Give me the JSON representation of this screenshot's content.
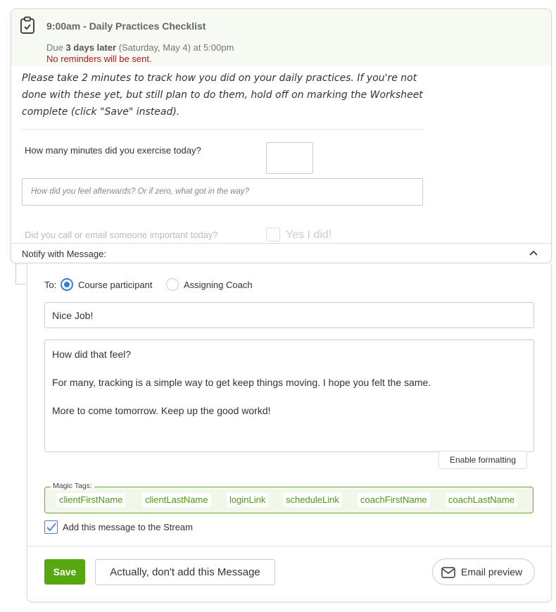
{
  "task": {
    "title": "9:00am - Daily Practices Checklist",
    "due_prefix": "Due ",
    "due_bold": "3 days later",
    "due_suffix": " (Saturday, May 4) at 5:00pm",
    "reminders": "No reminders will be sent.",
    "icon": "clipboard-check-icon"
  },
  "worksheet": {
    "intro": "Please take 2 minutes to track how you did on your daily practices. If you're not done with these yet, but still plan to do them, hold off on marking the Worksheet complete (click \"Save\" instead).",
    "q1": "How many minutes did you exercise today?",
    "q1_value": "",
    "feel_placeholder": "How did you feel afterwards? Or if zero, what got in the way?",
    "q2": "Did you call or email someone important today?",
    "q2_option": "Yes I did!"
  },
  "notify": {
    "label": "Notify with Message:"
  },
  "message": {
    "to_label": "To:",
    "recipients": [
      {
        "label": "Course participant",
        "selected": true
      },
      {
        "label": "Assigning Coach",
        "selected": false
      }
    ],
    "subject": "Nice Job!",
    "body": [
      "How did that feel?",
      "For many, tracking is a simple way to get keep things moving. I hope you felt the same.",
      "More to come tomorrow. Keep up the good workd!"
    ],
    "enable_formatting": "Enable formatting",
    "magic_tags_label": "Magic Tags:",
    "magic_tags": [
      "clientFirstName",
      "clientLastName",
      "loginLink",
      "scheduleLink",
      "coachFirstName",
      "coachLastName"
    ],
    "stream_label": "Add this message to the Stream",
    "stream_checked": true
  },
  "actions": {
    "save": "Save",
    "cancel": "Actually, don't add this Message",
    "preview": "Email preview"
  },
  "colors": {
    "accent": "#56a80e",
    "radio": "#3b7ddd",
    "warning": "#b01c1c"
  }
}
